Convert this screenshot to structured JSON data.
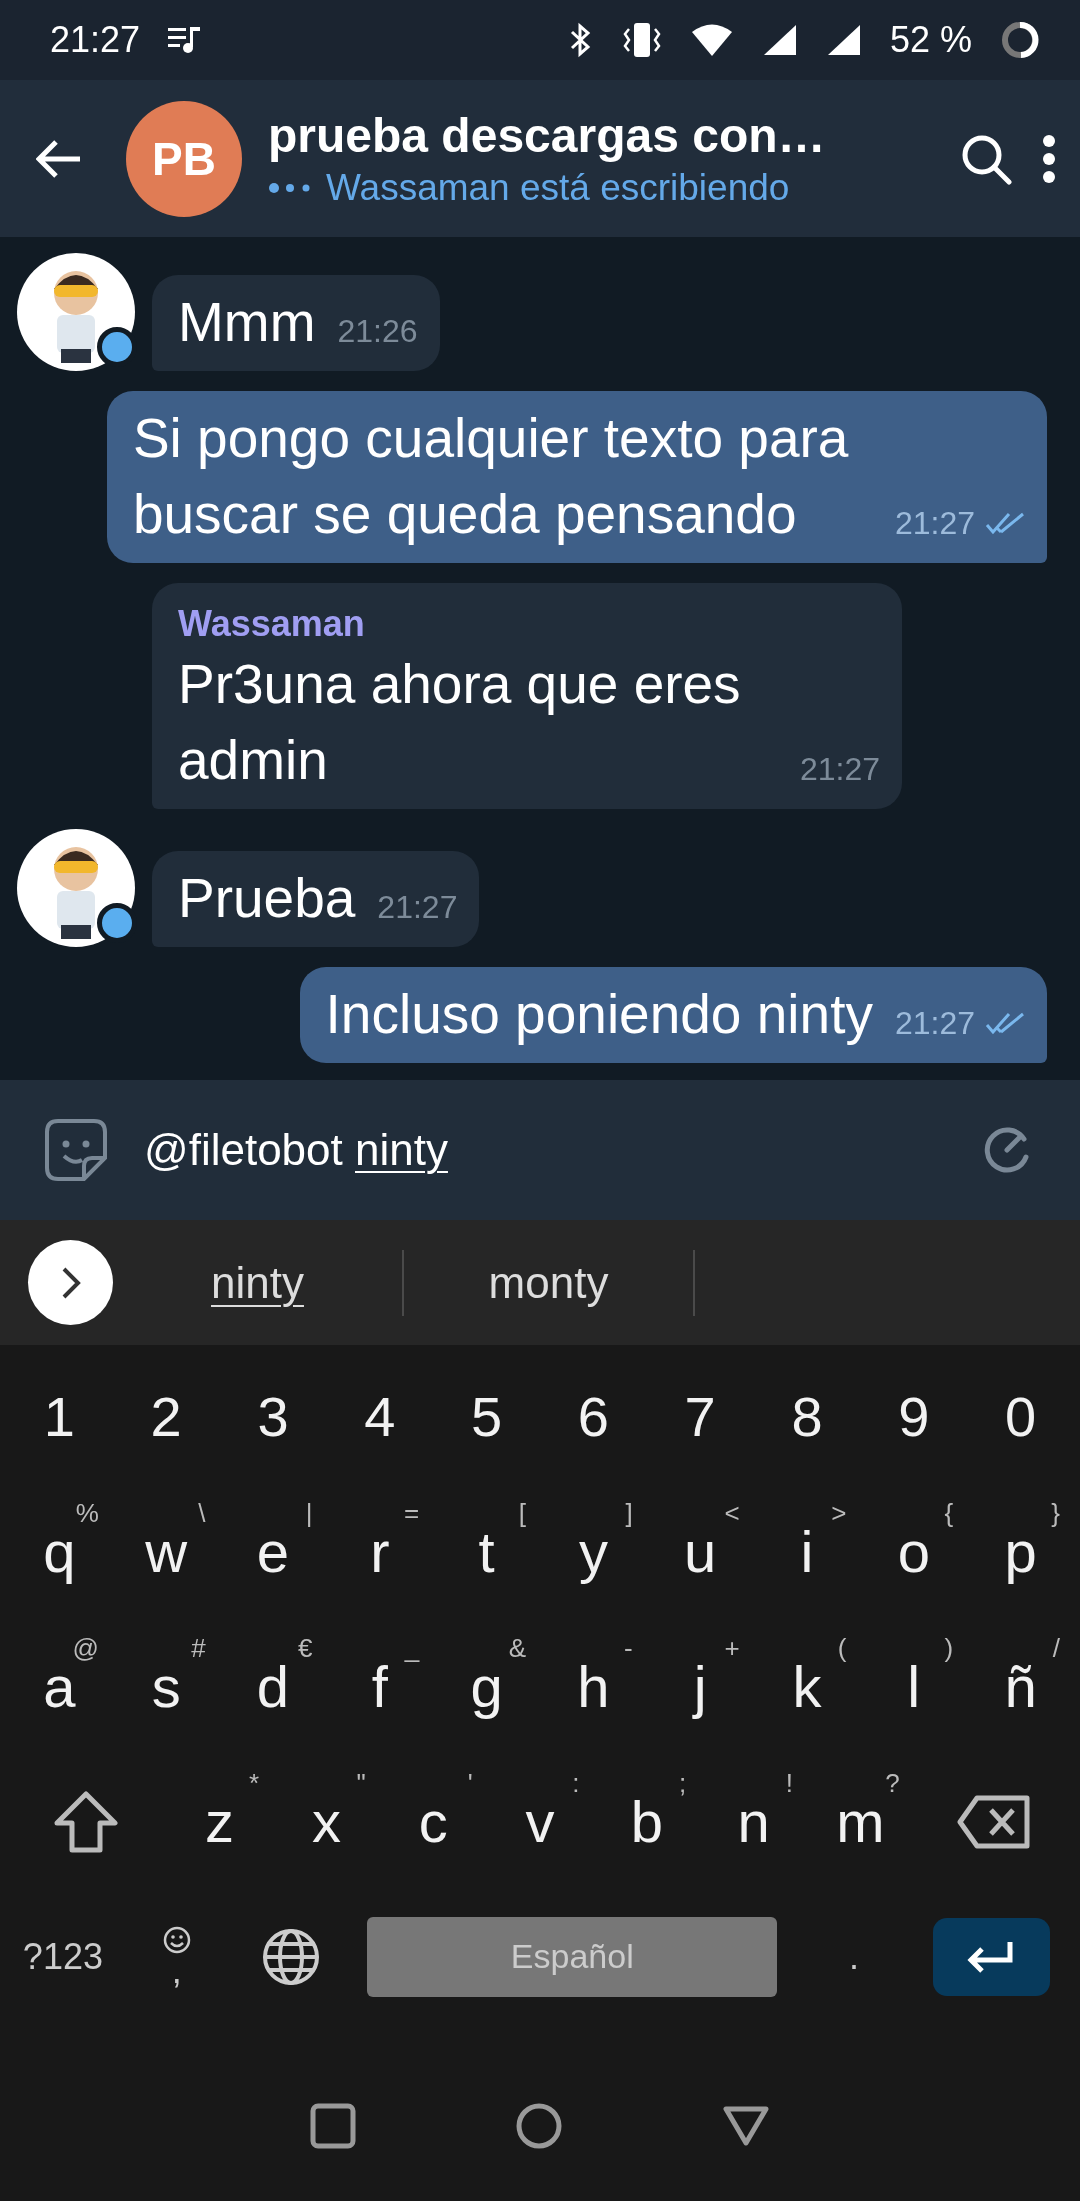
{
  "status_bar": {
    "time": "21:27",
    "battery": "52 %"
  },
  "header": {
    "initials": "PB",
    "title": "prueba descargas con…",
    "status": "Wassaman está escribiendo",
    "typing": true
  },
  "messages": [
    {
      "kind": "incoming",
      "text": "Mmm",
      "time": "21:26",
      "avatar": true,
      "online": true
    },
    {
      "kind": "outgoing",
      "text": "Si pongo cualquier texto para buscar se queda pensando",
      "time": "21:27",
      "read": true
    },
    {
      "kind": "incoming",
      "sender": "Wassaman",
      "text": "Pr3una ahora que eres admin",
      "time": "21:27",
      "avatar": false
    },
    {
      "kind": "incoming",
      "text": "Prueba",
      "time": "21:27",
      "avatar": true,
      "online": true
    },
    {
      "kind": "outgoing",
      "text": "Incluso poniendo ninty",
      "time": "21:27",
      "read": true
    }
  ],
  "composer": {
    "value": "@filetobot ",
    "composing": "ninty"
  },
  "suggestions": [
    {
      "text": "ninty",
      "selected": true
    },
    {
      "text": "monty",
      "selected": false
    }
  ],
  "keyboard": {
    "number_row": [
      "1",
      "2",
      "3",
      "4",
      "5",
      "6",
      "7",
      "8",
      "9",
      "0"
    ],
    "letter_rows": [
      [
        {
          "kind": "char",
          "key": "q",
          "hint": "%"
        },
        {
          "kind": "char",
          "key": "w",
          "hint": "\\"
        },
        {
          "kind": "char",
          "key": "e",
          "hint": "|"
        },
        {
          "kind": "char",
          "key": "r",
          "hint": "="
        },
        {
          "kind": "char",
          "key": "t",
          "hint": "["
        },
        {
          "kind": "char",
          "key": "y",
          "hint": "]"
        },
        {
          "kind": "char",
          "key": "u",
          "hint": "<"
        },
        {
          "kind": "char",
          "key": "i",
          "hint": ">"
        },
        {
          "kind": "char",
          "key": "o",
          "hint": "{"
        },
        {
          "kind": "char",
          "key": "p",
          "hint": "}"
        }
      ],
      [
        {
          "kind": "char",
          "key": "a",
          "hint": "@"
        },
        {
          "kind": "char",
          "key": "s",
          "hint": "#"
        },
        {
          "kind": "char",
          "key": "d",
          "hint": "€"
        },
        {
          "kind": "char",
          "key": "f",
          "hint": "_"
        },
        {
          "kind": "char",
          "key": "g",
          "hint": "&"
        },
        {
          "kind": "char",
          "key": "h",
          "hint": "-"
        },
        {
          "kind": "char",
          "key": "j",
          "hint": "+"
        },
        {
          "kind": "char",
          "key": "k",
          "hint": "("
        },
        {
          "kind": "char",
          "key": "l",
          "hint": ")"
        },
        {
          "kind": "char",
          "key": "ñ",
          "hint": "/"
        }
      ],
      [
        {
          "kind": "shift"
        },
        {
          "kind": "char",
          "key": "z",
          "hint": "*"
        },
        {
          "kind": "char",
          "key": "x",
          "hint": "\""
        },
        {
          "kind": "char",
          "key": "c",
          "hint": "'"
        },
        {
          "kind": "char",
          "key": "v",
          "hint": ":"
        },
        {
          "kind": "char",
          "key": "b",
          "hint": ";"
        },
        {
          "kind": "char",
          "key": "n",
          "hint": "!"
        },
        {
          "kind": "char",
          "key": "m",
          "hint": "?"
        },
        {
          "kind": "backspace"
        }
      ]
    ],
    "bottom_row": [
      {
        "kind": "symbols",
        "label": "?123"
      },
      {
        "kind": "emoji",
        "label": ","
      },
      {
        "kind": "globe"
      },
      {
        "kind": "space",
        "label": "Español"
      },
      {
        "kind": "char",
        "label": "."
      },
      {
        "kind": "enter"
      }
    ]
  }
}
